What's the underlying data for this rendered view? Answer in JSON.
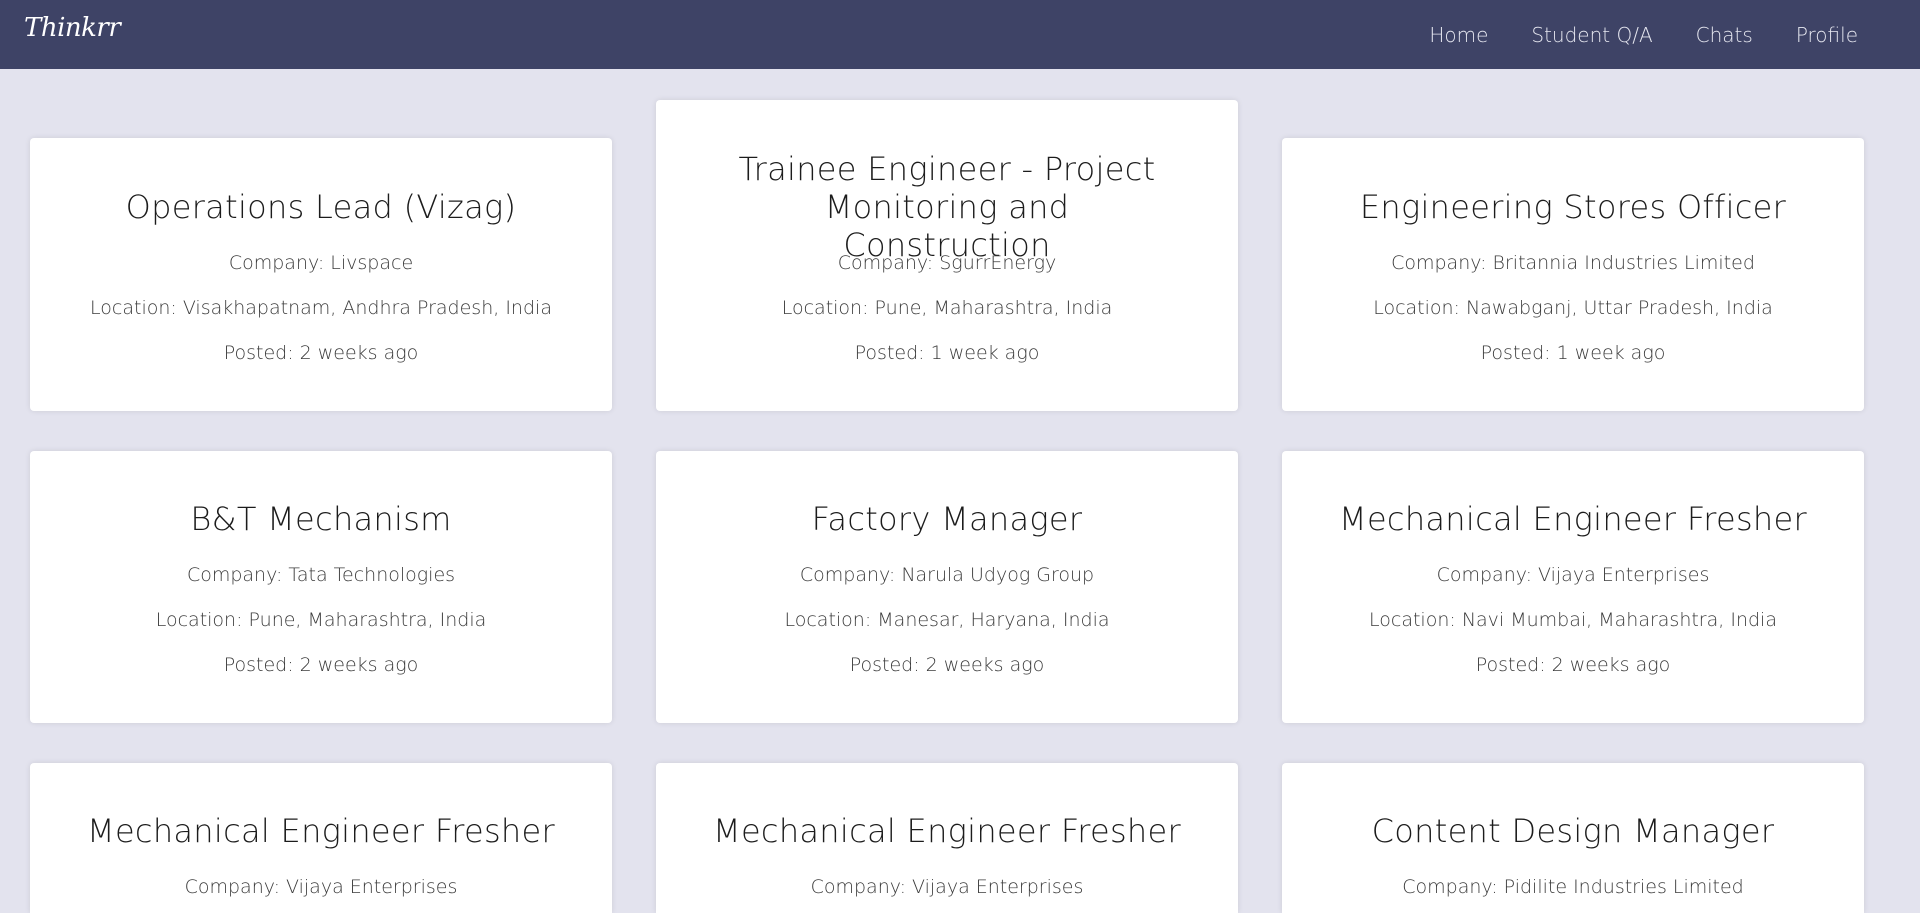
{
  "nav": {
    "brand": "Thinkrr",
    "links": [
      {
        "label": "Home"
      },
      {
        "label": "Student Q/A"
      },
      {
        "label": "Chats"
      },
      {
        "label": "Profile"
      }
    ]
  },
  "jobs": [
    {
      "title": "Operations Lead (Vizag)",
      "company": "Company: Livspace",
      "location": "Location: Visakhapatnam, Andhra Pradesh, India",
      "posted": "Posted: 2 weeks ago"
    },
    {
      "title": "Trainee Engineer - Project Monitoring and Construction",
      "company": "Company: SgurrEnergy",
      "location": "Location: Pune, Maharashtra, India",
      "posted": "Posted: 1 week ago"
    },
    {
      "title": "Engineering Stores Officer",
      "company": "Company: Britannia Industries Limited",
      "location": "Location: Nawabganj, Uttar Pradesh, India",
      "posted": "Posted: 1 week ago"
    },
    {
      "title": "B&T Mechanism",
      "company": "Company: Tata Technologies",
      "location": "Location: Pune, Maharashtra, India",
      "posted": "Posted: 2 weeks ago"
    },
    {
      "title": "Factory Manager",
      "company": "Company: Narula Udyog Group",
      "location": "Location: Manesar, Haryana, India",
      "posted": "Posted: 2 weeks ago"
    },
    {
      "title": "Mechanical Engineer Fresher",
      "company": "Company: Vijaya Enterprises",
      "location": "Location: Navi Mumbai, Maharashtra, India",
      "posted": "Posted: 2 weeks ago"
    },
    {
      "title": "Mechanical Engineer Fresher",
      "company": "Company: Vijaya Enterprises"
    },
    {
      "title": "Mechanical Engineer Fresher",
      "company": "Company: Vijaya Enterprises"
    },
    {
      "title": "Content Design Manager",
      "company": "Company: Pidilite Industries Limited"
    }
  ]
}
